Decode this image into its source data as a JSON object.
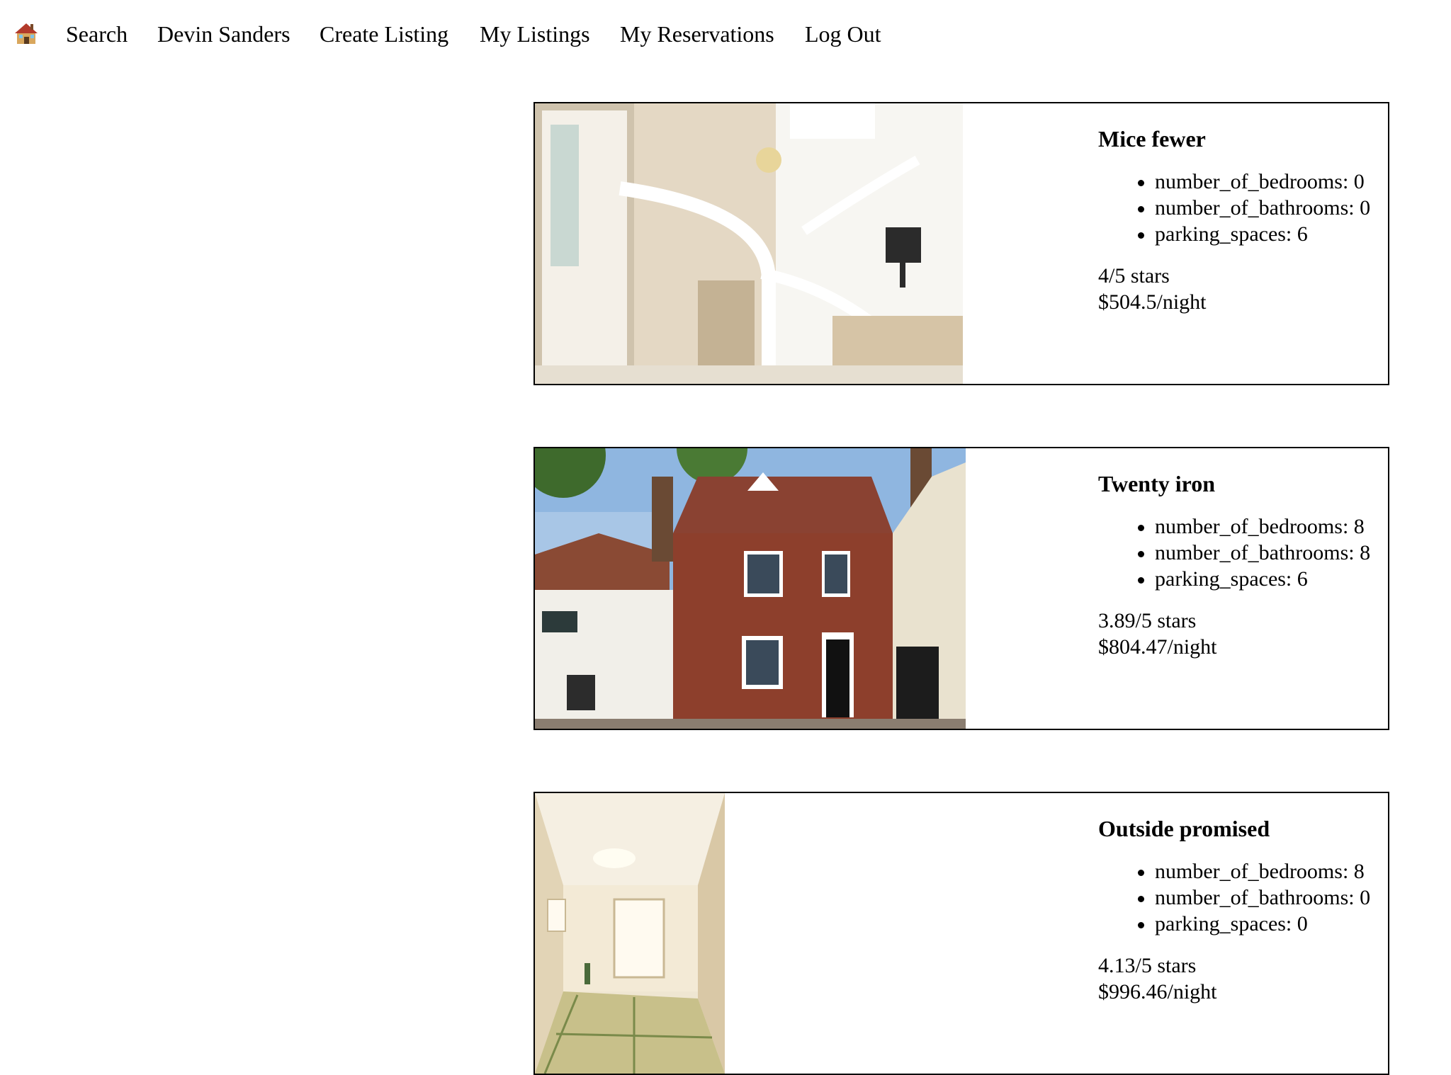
{
  "nav": {
    "home_icon": "house-icon",
    "links": [
      "Search",
      "Devin Sanders",
      "Create Listing",
      "My Listings",
      "My Reservations",
      "Log Out"
    ]
  },
  "listings": [
    {
      "title": "Mice fewer",
      "photo": "foyer-staircase-photo",
      "attributes": [
        "number_of_bedrooms: 0",
        "number_of_bathrooms: 0",
        "parking_spaces: 6"
      ],
      "rating": "4/5 stars",
      "price": "$504.5/night"
    },
    {
      "title": "Twenty iron",
      "photo": "brick-house-exterior-photo",
      "attributes": [
        "number_of_bedrooms: 8",
        "number_of_bathrooms: 8",
        "parking_spaces: 6"
      ],
      "rating": "3.89/5 stars",
      "price": "$804.47/night"
    },
    {
      "title": "Outside promised",
      "photo": "tatami-room-photo",
      "attributes": [
        "number_of_bedrooms: 8",
        "number_of_bathrooms: 0",
        "parking_spaces: 0"
      ],
      "rating": "4.13/5 stars",
      "price": "$996.46/night"
    }
  ]
}
